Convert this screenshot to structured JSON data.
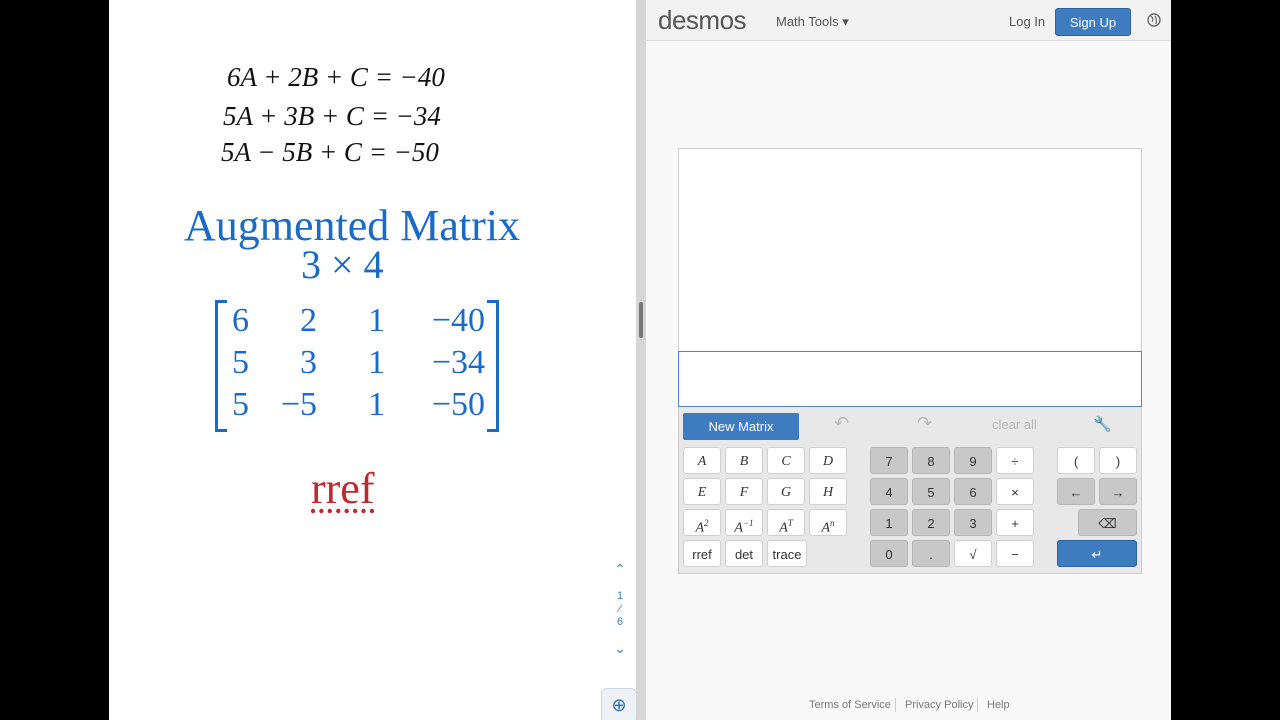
{
  "doc": {
    "equations": [
      "6A + 2B + C = −40",
      "5A + 3B + C = −34",
      "5A − 5B + C = −50"
    ],
    "title": "Augmented Matrix",
    "dimensions": "3 × 4",
    "matrix": [
      [
        "6",
        "2",
        "1",
        "−40"
      ],
      [
        "5",
        "3",
        "1",
        "−34"
      ],
      [
        "5",
        "−5",
        "1",
        "−50"
      ]
    ],
    "rref_label": "rref",
    "page_nav": {
      "current": "1",
      "sep": "⁄",
      "total": "6",
      "up": "⌃",
      "down": "⌄"
    },
    "zoom_icon": "⊕"
  },
  "desmos": {
    "logo": "desmos",
    "math_tools": "Math Tools ▾",
    "login": "Log In",
    "signup": "Sign Up",
    "toolbar": {
      "new_matrix": "New Matrix",
      "undo": "↶",
      "redo": "↷",
      "clear_all": "clear all",
      "wrench": "🔧"
    },
    "keys": {
      "letters": [
        "A",
        "B",
        "C",
        "D",
        "E",
        "F",
        "G",
        "H"
      ],
      "powers": [
        {
          "base": "A",
          "sup": "2"
        },
        {
          "base": "A",
          "sup": "−1"
        },
        {
          "base": "A",
          "sup": "T"
        },
        {
          "base": "A",
          "sup": "n"
        }
      ],
      "funcs": [
        "rref",
        "det",
        "trace"
      ],
      "digits_row1": [
        "7",
        "8",
        "9",
        "÷"
      ],
      "digits_row2": [
        "4",
        "5",
        "6",
        "×"
      ],
      "digits_row3": [
        "1",
        "2",
        "3",
        "+"
      ],
      "digits_row4": [
        "0",
        ".",
        "√",
        "−"
      ],
      "parens": [
        "(",
        ")"
      ],
      "arrows": [
        "←",
        "→"
      ],
      "backspace": "⌫",
      "enter": "↵"
    },
    "footer": [
      "Terms of Service",
      "Privacy Policy",
      "Help"
    ]
  },
  "colors": {
    "blue_text": "#1a6ac8",
    "red_text": "#c0282d",
    "desmos_blue": "#3f7bbf"
  }
}
